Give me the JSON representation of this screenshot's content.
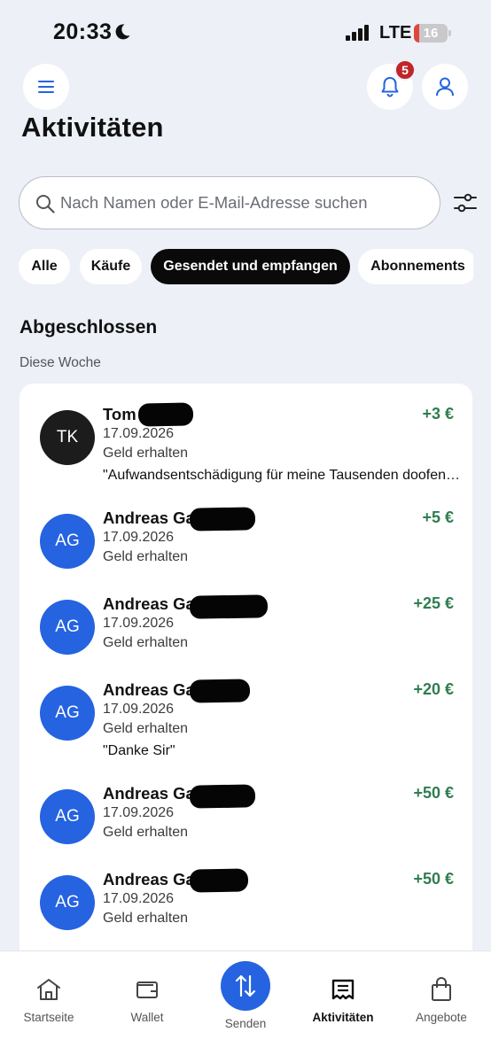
{
  "status": {
    "time": "20:33",
    "network": "LTE",
    "battery": "16",
    "battery_level": 0.16
  },
  "header": {
    "notification_count": "5"
  },
  "page_title": "Aktivitäten",
  "search": {
    "placeholder": "Nach Namen oder E-Mail-Adresse suchen"
  },
  "filters": [
    "Alle",
    "Käufe",
    "Gesendet und empfangen",
    "Abonnements"
  ],
  "active_filter": "Gesendet und empfangen",
  "section": {
    "title": "Abgeschlossen",
    "subtitle": "Diese Woche"
  },
  "transactions": [
    {
      "initials": "TK",
      "name": "Tom Klein",
      "amount": "+3 €",
      "date": "17.09.2026",
      "type": "Geld erhalten",
      "note": "\"Aufwandsentschädigung für meine Tausenden doofen…",
      "avatar_color": "#1c1c1c"
    },
    {
      "initials": "AG",
      "name": "Andreas Ga",
      "amount": "+5 €",
      "date": "17.09.2026",
      "type": "Geld erhalten",
      "note": "",
      "avatar_color": "#2563e0"
    },
    {
      "initials": "AG",
      "name": "Andreas Ga",
      "amount": "+25 €",
      "date": "17.09.2026",
      "type": "Geld erhalten",
      "note": "",
      "avatar_color": "#2563e0"
    },
    {
      "initials": "AG",
      "name": "Andreas Ga",
      "amount": "+20 €",
      "date": "17.09.2026",
      "type": "Geld erhalten",
      "note": "\"Danke Sir\"",
      "avatar_color": "#2563e0"
    },
    {
      "initials": "AG",
      "name": "Andreas Ga",
      "amount": "+50 €",
      "date": "17.09.2026",
      "type": "Geld erhalten",
      "note": "",
      "avatar_color": "#2563e0"
    },
    {
      "initials": "AG",
      "name": "Andreas Ga",
      "amount": "+50 €",
      "date": "17.09.2026",
      "type": "Geld erhalten",
      "note": "",
      "avatar_color": "#2563e0"
    }
  ],
  "nav": {
    "home": "Startseite",
    "wallet": "Wallet",
    "send": "Senden",
    "activities": "Aktivitäten",
    "offers": "Angebote"
  },
  "colors": {
    "accent": "#2563e0",
    "positive": "#2f7d4f",
    "badge": "#c0252a"
  }
}
